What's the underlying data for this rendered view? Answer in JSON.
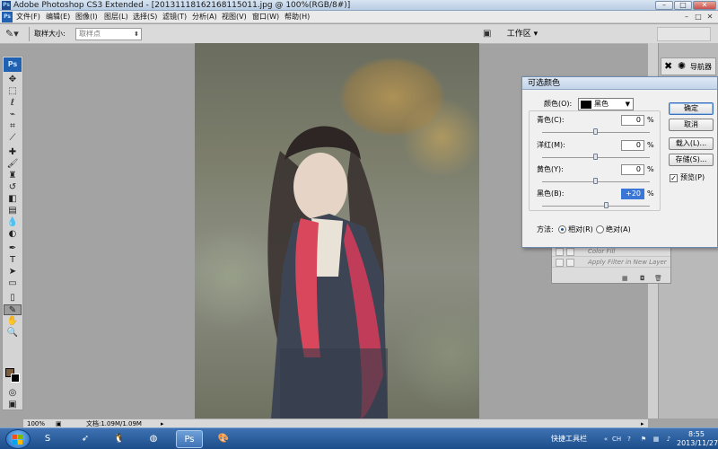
{
  "window": {
    "title": "Adobe Photoshop CS3 Extended - [20131118162168115011.jpg @ 100%(RGB/8#)]",
    "controls": {
      "minimize": "–",
      "maximize": "□",
      "close": "✕"
    }
  },
  "menubar": {
    "items": [
      "文件(F)",
      "编辑(E)",
      "图像(I)",
      "图层(L)",
      "选择(S)",
      "滤镜(T)",
      "分析(A)",
      "视图(V)",
      "窗口(W)",
      "帮助(H)"
    ]
  },
  "options": {
    "tool_icon": "eyedropper-icon",
    "sample_size_label": "取样大小:",
    "sample_size_value": "取样点",
    "workspace_label": "工作区 ▾"
  },
  "toolbox": {
    "logo": "Ps",
    "tools": [
      "move-icon",
      "marquee-icon",
      "lasso-icon",
      "quick-select-icon",
      "crop-icon",
      "slice-icon",
      "heal-icon",
      "brush-icon",
      "clone-stamp-icon",
      "history-brush-icon",
      "eraser-icon",
      "gradient-icon",
      "blur-icon",
      "dodge-icon",
      "pen-icon",
      "type-icon",
      "path-select-icon",
      "shape-icon",
      "notes-icon",
      "eyedropper-icon",
      "hand-icon",
      "zoom-icon"
    ],
    "foreground_color": "#7b5d3e",
    "background_color": "#000000"
  },
  "dock": {
    "navigator_label": "导航器"
  },
  "history_panel": {
    "rows": [
      "Color Fill",
      "Apply Filter in New Layer"
    ]
  },
  "dialog": {
    "title": "可选颜色",
    "color_label": "颜色(O):",
    "color_value": "黑色",
    "sliders": [
      {
        "label": "青色(C):",
        "value": "0",
        "percent": 0
      },
      {
        "label": "洋红(M):",
        "value": "0",
        "percent": 0
      },
      {
        "label": "黄色(Y):",
        "value": "0",
        "percent": 0
      },
      {
        "label": "黑色(B):",
        "value": "+20",
        "percent": 20
      }
    ],
    "unit": "%",
    "buttons": {
      "ok": "确定",
      "cancel": "取消",
      "load": "载入(L)...",
      "save": "存储(S)..."
    },
    "preview_label": "预览(P)",
    "preview_checked": true,
    "method_label": "方法:",
    "method_relative": "相对(R)",
    "method_absolute": "绝对(A)",
    "method_selected": "relative"
  },
  "statusbar": {
    "zoom": "100%",
    "doc_info": "文档:1.09M/1.09M"
  },
  "taskbar": {
    "quick_launch_label": "快捷工具栏",
    "tray_input": "CH",
    "time": "8:55",
    "date": "2013/11/27"
  }
}
